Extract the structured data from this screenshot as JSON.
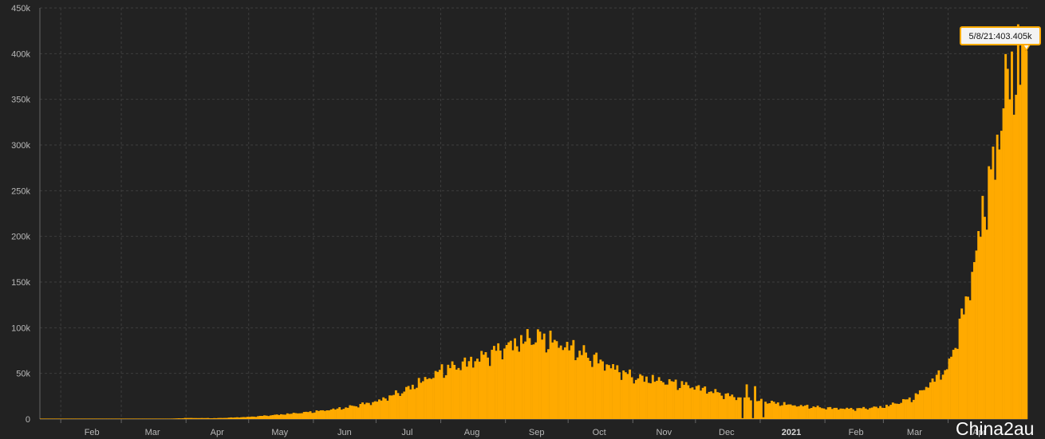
{
  "chart_data": {
    "type": "bar",
    "x_start": "2020-01-22",
    "x_end": "2021-05-08",
    "ylim": [
      0,
      450000
    ],
    "yticks": [
      0,
      50000,
      100000,
      150000,
      200000,
      250000,
      300000,
      350000,
      400000,
      450000
    ],
    "ytick_labels": [
      "0",
      "50k",
      "100k",
      "150k",
      "200k",
      "250k",
      "300k",
      "350k",
      "400k",
      "450k"
    ],
    "xtick_labels": [
      {
        "date": "2020-02-01",
        "label": "Feb"
      },
      {
        "date": "2020-03-01",
        "label": "Mar"
      },
      {
        "date": "2020-04-01",
        "label": "Apr"
      },
      {
        "date": "2020-05-01",
        "label": "May"
      },
      {
        "date": "2020-06-01",
        "label": "Jun"
      },
      {
        "date": "2020-07-01",
        "label": "Jul"
      },
      {
        "date": "2020-08-01",
        "label": "Aug"
      },
      {
        "date": "2020-09-01",
        "label": "Sep"
      },
      {
        "date": "2020-10-01",
        "label": "Oct"
      },
      {
        "date": "2020-11-01",
        "label": "Nov"
      },
      {
        "date": "2020-12-01",
        "label": "Dec"
      },
      {
        "date": "2021-01-01",
        "label": "2021",
        "bold": true
      },
      {
        "date": "2021-02-01",
        "label": "Feb"
      },
      {
        "date": "2021-03-01",
        "label": "Mar"
      },
      {
        "date": "2021-04-01",
        "label": "Apr"
      }
    ],
    "grid": true,
    "bar_color": "#ffaa00",
    "profile": [
      {
        "date": "2020-01-22",
        "value": 0
      },
      {
        "date": "2020-03-01",
        "value": 0
      },
      {
        "date": "2020-03-20",
        "value": 100
      },
      {
        "date": "2020-04-01",
        "value": 1200
      },
      {
        "date": "2020-04-15",
        "value": 1000
      },
      {
        "date": "2020-05-01",
        "value": 2500
      },
      {
        "date": "2020-05-15",
        "value": 5000
      },
      {
        "date": "2020-06-01",
        "value": 8500
      },
      {
        "date": "2020-06-15",
        "value": 12500
      },
      {
        "date": "2020-07-01",
        "value": 20000
      },
      {
        "date": "2020-07-15",
        "value": 33000
      },
      {
        "date": "2020-08-01",
        "value": 55000
      },
      {
        "date": "2020-08-15",
        "value": 65000
      },
      {
        "date": "2020-09-01",
        "value": 82000
      },
      {
        "date": "2020-09-15",
        "value": 93000
      },
      {
        "date": "2020-09-30",
        "value": 82000
      },
      {
        "date": "2020-10-15",
        "value": 66000
      },
      {
        "date": "2020-11-01",
        "value": 47000
      },
      {
        "date": "2020-11-15",
        "value": 43000
      },
      {
        "date": "2020-12-01",
        "value": 36000
      },
      {
        "date": "2020-12-15",
        "value": 27000
      },
      {
        "date": "2021-01-01",
        "value": 20000
      },
      {
        "date": "2021-01-15",
        "value": 16000
      },
      {
        "date": "2021-02-01",
        "value": 12500
      },
      {
        "date": "2021-02-15",
        "value": 11500
      },
      {
        "date": "2021-03-01",
        "value": 14000
      },
      {
        "date": "2021-03-15",
        "value": 24000
      },
      {
        "date": "2021-04-01",
        "value": 60000
      },
      {
        "date": "2021-04-10",
        "value": 140000
      },
      {
        "date": "2021-04-18",
        "value": 240000
      },
      {
        "date": "2021-04-25",
        "value": 345000
      },
      {
        "date": "2021-05-01",
        "value": 390000
      },
      {
        "date": "2021-05-08",
        "value": 403405
      }
    ],
    "highlights": [
      {
        "date": "2020-12-25",
        "value": 38000
      },
      {
        "date": "2020-12-29",
        "value": 36000
      },
      {
        "date": "2021-01-03",
        "value": 19000
      },
      {
        "date": "2021-04-23",
        "value": 262000
      },
      {
        "date": "2021-05-03",
        "value": 355000
      },
      {
        "date": "2021-05-06",
        "value": 412000
      }
    ],
    "dips": [
      {
        "date": "2020-12-23",
        "value": 1000
      },
      {
        "date": "2020-12-28",
        "value": 1000
      },
      {
        "date": "2021-01-02",
        "value": 2000
      }
    ],
    "tooltip": {
      "date": "2021-05-08",
      "label": "5/8/21:403.405k"
    }
  },
  "watermark": "China2au"
}
